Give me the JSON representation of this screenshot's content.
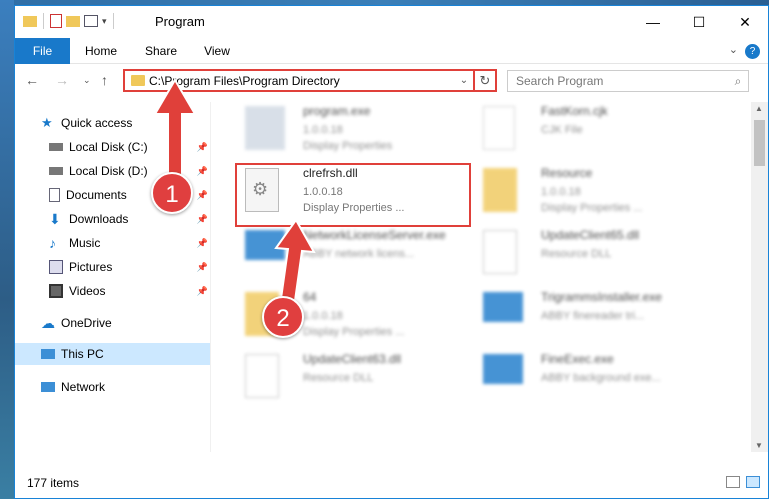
{
  "window": {
    "title": "Program"
  },
  "ribbon": {
    "tabs": [
      "File",
      "Home",
      "Share",
      "View"
    ]
  },
  "address": {
    "path": "C:\\Program Files\\Program Directory"
  },
  "search": {
    "placeholder": "Search Program"
  },
  "sidebar": {
    "items": [
      {
        "label": "Quick access",
        "icon": "star-icon",
        "pinned": false
      },
      {
        "label": "Local Disk (C:)",
        "icon": "drive-icon",
        "pinned": true
      },
      {
        "label": "Local Disk (D:)",
        "icon": "drive-icon",
        "pinned": true
      },
      {
        "label": "Documents",
        "icon": "documents-icon",
        "pinned": true
      },
      {
        "label": "Downloads",
        "icon": "download-icon",
        "pinned": true
      },
      {
        "label": "Music",
        "icon": "music-icon",
        "pinned": true
      },
      {
        "label": "Pictures",
        "icon": "pictures-icon",
        "pinned": true
      },
      {
        "label": "Videos",
        "icon": "video-icon",
        "pinned": true
      },
      {
        "label": "OneDrive",
        "icon": "cloud-icon",
        "pinned": false
      },
      {
        "label": "This PC",
        "icon": "computer-icon",
        "pinned": false
      },
      {
        "label": "Network",
        "icon": "network-icon",
        "pinned": false
      }
    ]
  },
  "files": [
    {
      "name": "program.exe",
      "l2": "1.0.0.18",
      "l3": "Display Properties"
    },
    {
      "name": "FastKorn.cjk",
      "l2": "CJK File",
      "l3": ""
    },
    {
      "name": "clrefrsh.dll",
      "l2": "1.0.0.18",
      "l3": "Display Properties ..."
    },
    {
      "name": "Resource",
      "l2": "1.0.0.18",
      "l3": "Display Properties ..."
    },
    {
      "name": "NetworkLicenseServer.exe",
      "l2": "ABBY network licens...",
      "l3": ""
    },
    {
      "name": "UpdateClient65.dll",
      "l2": "Resource DLL",
      "l3": ""
    },
    {
      "name": "64",
      "l2": "1.0.0.18",
      "l3": "Display Properties ..."
    },
    {
      "name": "TrigrammsInstaller.exe",
      "l2": "ABBY finereader tri...",
      "l3": ""
    },
    {
      "name": "UpdateClient63.dll",
      "l2": "Resource DLL",
      "l3": ""
    },
    {
      "name": "FineExec.exe",
      "l2": "ABBY background exe...",
      "l3": ""
    }
  ],
  "status": {
    "count": "177 items"
  },
  "badges": [
    "1",
    "2"
  ],
  "colors": {
    "accent": "#1979ca",
    "highlight": "#e0403a"
  }
}
